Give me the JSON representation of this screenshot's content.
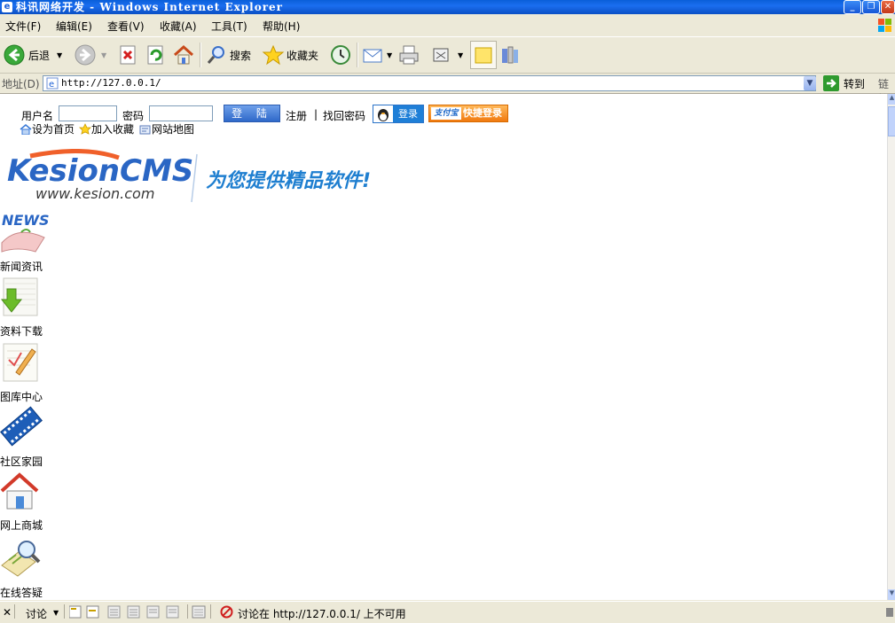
{
  "window": {
    "title": "科讯网络开发 - Windows Internet Explorer"
  },
  "menu": {
    "items": [
      "文件(F)",
      "编辑(E)",
      "查看(V)",
      "收藏(A)",
      "工具(T)",
      "帮助(H)"
    ]
  },
  "toolbar": {
    "back_label": "后退",
    "search_label": "搜索",
    "favorites_label": "收藏夹"
  },
  "address": {
    "label": "地址(D)",
    "url": "http://127.0.0.1/",
    "go_label": "转到",
    "links_label": "链接"
  },
  "page": {
    "login": {
      "username_label": "用户名",
      "password_label": "密码",
      "login_button": "登 陆",
      "register_link": "注册",
      "separator": "|",
      "recover_link": "找回密码",
      "qq_login": "登录",
      "alipay_badge": "支付宝",
      "alipay_quick": "快捷登录"
    },
    "quick_links": [
      "设为首页",
      "加入收藏",
      "网站地图"
    ],
    "logo": {
      "brand": "KesionCMS",
      "url_text": "www.kesion.com",
      "slogan": "为您提供精品软件!"
    },
    "nav": [
      {
        "label": "新闻资讯",
        "icon": "news-icon"
      },
      {
        "label": "资料下载",
        "icon": "download-icon"
      },
      {
        "label": "图库中心",
        "icon": "gallery-icon"
      },
      {
        "label": "社区家园",
        "icon": "film-icon"
      },
      {
        "label": "网上商城",
        "icon": "house-icon"
      },
      {
        "label": "在线答疑",
        "icon": "magnifier-icon"
      }
    ]
  },
  "statusbar": {
    "discuss_label": "讨论",
    "message": "讨论在 http://127.0.0.1/ 上不可用"
  }
}
